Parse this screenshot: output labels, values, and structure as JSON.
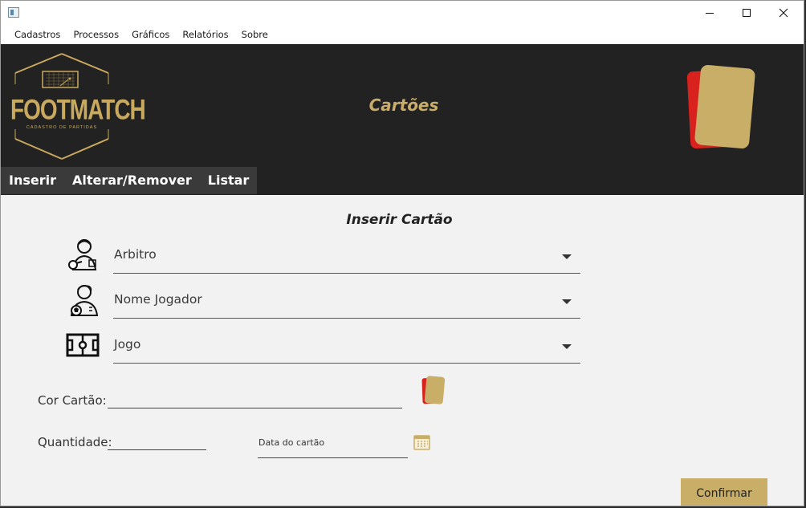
{
  "window": {
    "title": ""
  },
  "menu": {
    "items": [
      "Cadastros",
      "Processos",
      "Gráficos",
      "Relatórios",
      "Sobre"
    ]
  },
  "header": {
    "logo_title": "FOOTMATCH",
    "logo_subtitle": "CADASTRO DE PARTIDAS",
    "title": "Cartões"
  },
  "tabs": [
    "Inserir",
    "Alterar/Remover",
    "Listar"
  ],
  "form": {
    "title": "Inserir Cartão",
    "arbitro_label": "Arbitro",
    "jogador_label": "Nome Jogador",
    "jogo_label": "Jogo",
    "cor_label": "Cor Cartão:",
    "cor_value": "",
    "quantidade_label": "Quantidade:",
    "quantidade_value": "",
    "data_placeholder": "Data do cartão",
    "confirm_label": "Confirmar"
  },
  "icons": {
    "referee": "referee-icon",
    "player": "player-icon",
    "field": "soccer-field-icon",
    "cards": "cards-icon",
    "calendar": "calendar-icon"
  },
  "colors": {
    "gold": "#c8ae67",
    "dark": "#222222",
    "red": "#d9211d"
  }
}
